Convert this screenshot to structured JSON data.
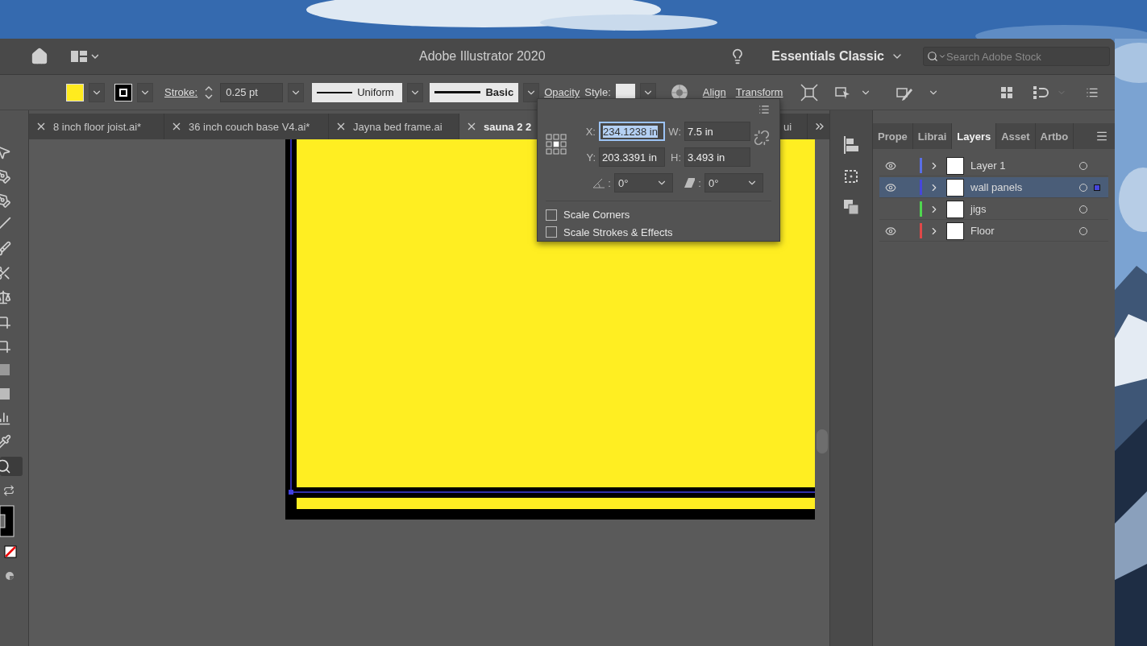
{
  "window": {
    "title": "Adobe Illustrator 2020"
  },
  "workspace": {
    "label": "Essentials Classic"
  },
  "search": {
    "placeholder": "Search Adobe Stock"
  },
  "control_bar": {
    "stroke_label": "Stroke:",
    "stroke_weight": "0.25 pt",
    "profile": "Uniform",
    "brush": "Basic",
    "opacity_label": "Opacity",
    "style_label": "Style:",
    "align_label": "Align",
    "transform_label": "Transform"
  },
  "tabs": [
    {
      "label": "8 inch floor joist.ai*",
      "selected": false
    },
    {
      "label": "36 inch couch base V4.ai*",
      "selected": false
    },
    {
      "label": "Jayna bed frame.ai",
      "selected": false
    },
    {
      "label": "sauna 2 2",
      "selected": true
    },
    {
      "label": "ui",
      "selected": false
    }
  ],
  "transform_panel": {
    "fields": [
      {
        "label": "X:",
        "value": "234.1238 in",
        "focused": true
      },
      {
        "label": "W:",
        "value": "7.5 in",
        "focused": false
      },
      {
        "label": "Y:",
        "value": "203.3391 in",
        "focused": false
      },
      {
        "label": "H:",
        "value": "3.493 in",
        "focused": false
      }
    ],
    "rotate_label": ":",
    "rotate": "0°",
    "shear_label": ":",
    "shear": "0°",
    "options": [
      {
        "label": "Scale Corners",
        "checked": false
      },
      {
        "label": "Scale Strokes & Effects",
        "checked": false
      }
    ]
  },
  "layers_panel": {
    "tabs": [
      {
        "label": "Prope",
        "selected": false
      },
      {
        "label": "Librai",
        "selected": false
      },
      {
        "label": "Layers",
        "selected": true
      },
      {
        "label": "Asset",
        "selected": false
      },
      {
        "label": "Artbo",
        "selected": false
      }
    ],
    "layers": [
      {
        "name": "Layer 1",
        "visible": true,
        "color": "#5a6fe6",
        "selected": false,
        "has_selection": false
      },
      {
        "name": "wall panels",
        "visible": true,
        "color": "#4646dc",
        "selected": true,
        "has_selection": true
      },
      {
        "name": "jigs",
        "visible": false,
        "color": "#4fd64f",
        "selected": false,
        "has_selection": false
      },
      {
        "name": "Floor",
        "visible": true,
        "color": "#e04848",
        "selected": false,
        "has_selection": false
      }
    ]
  }
}
